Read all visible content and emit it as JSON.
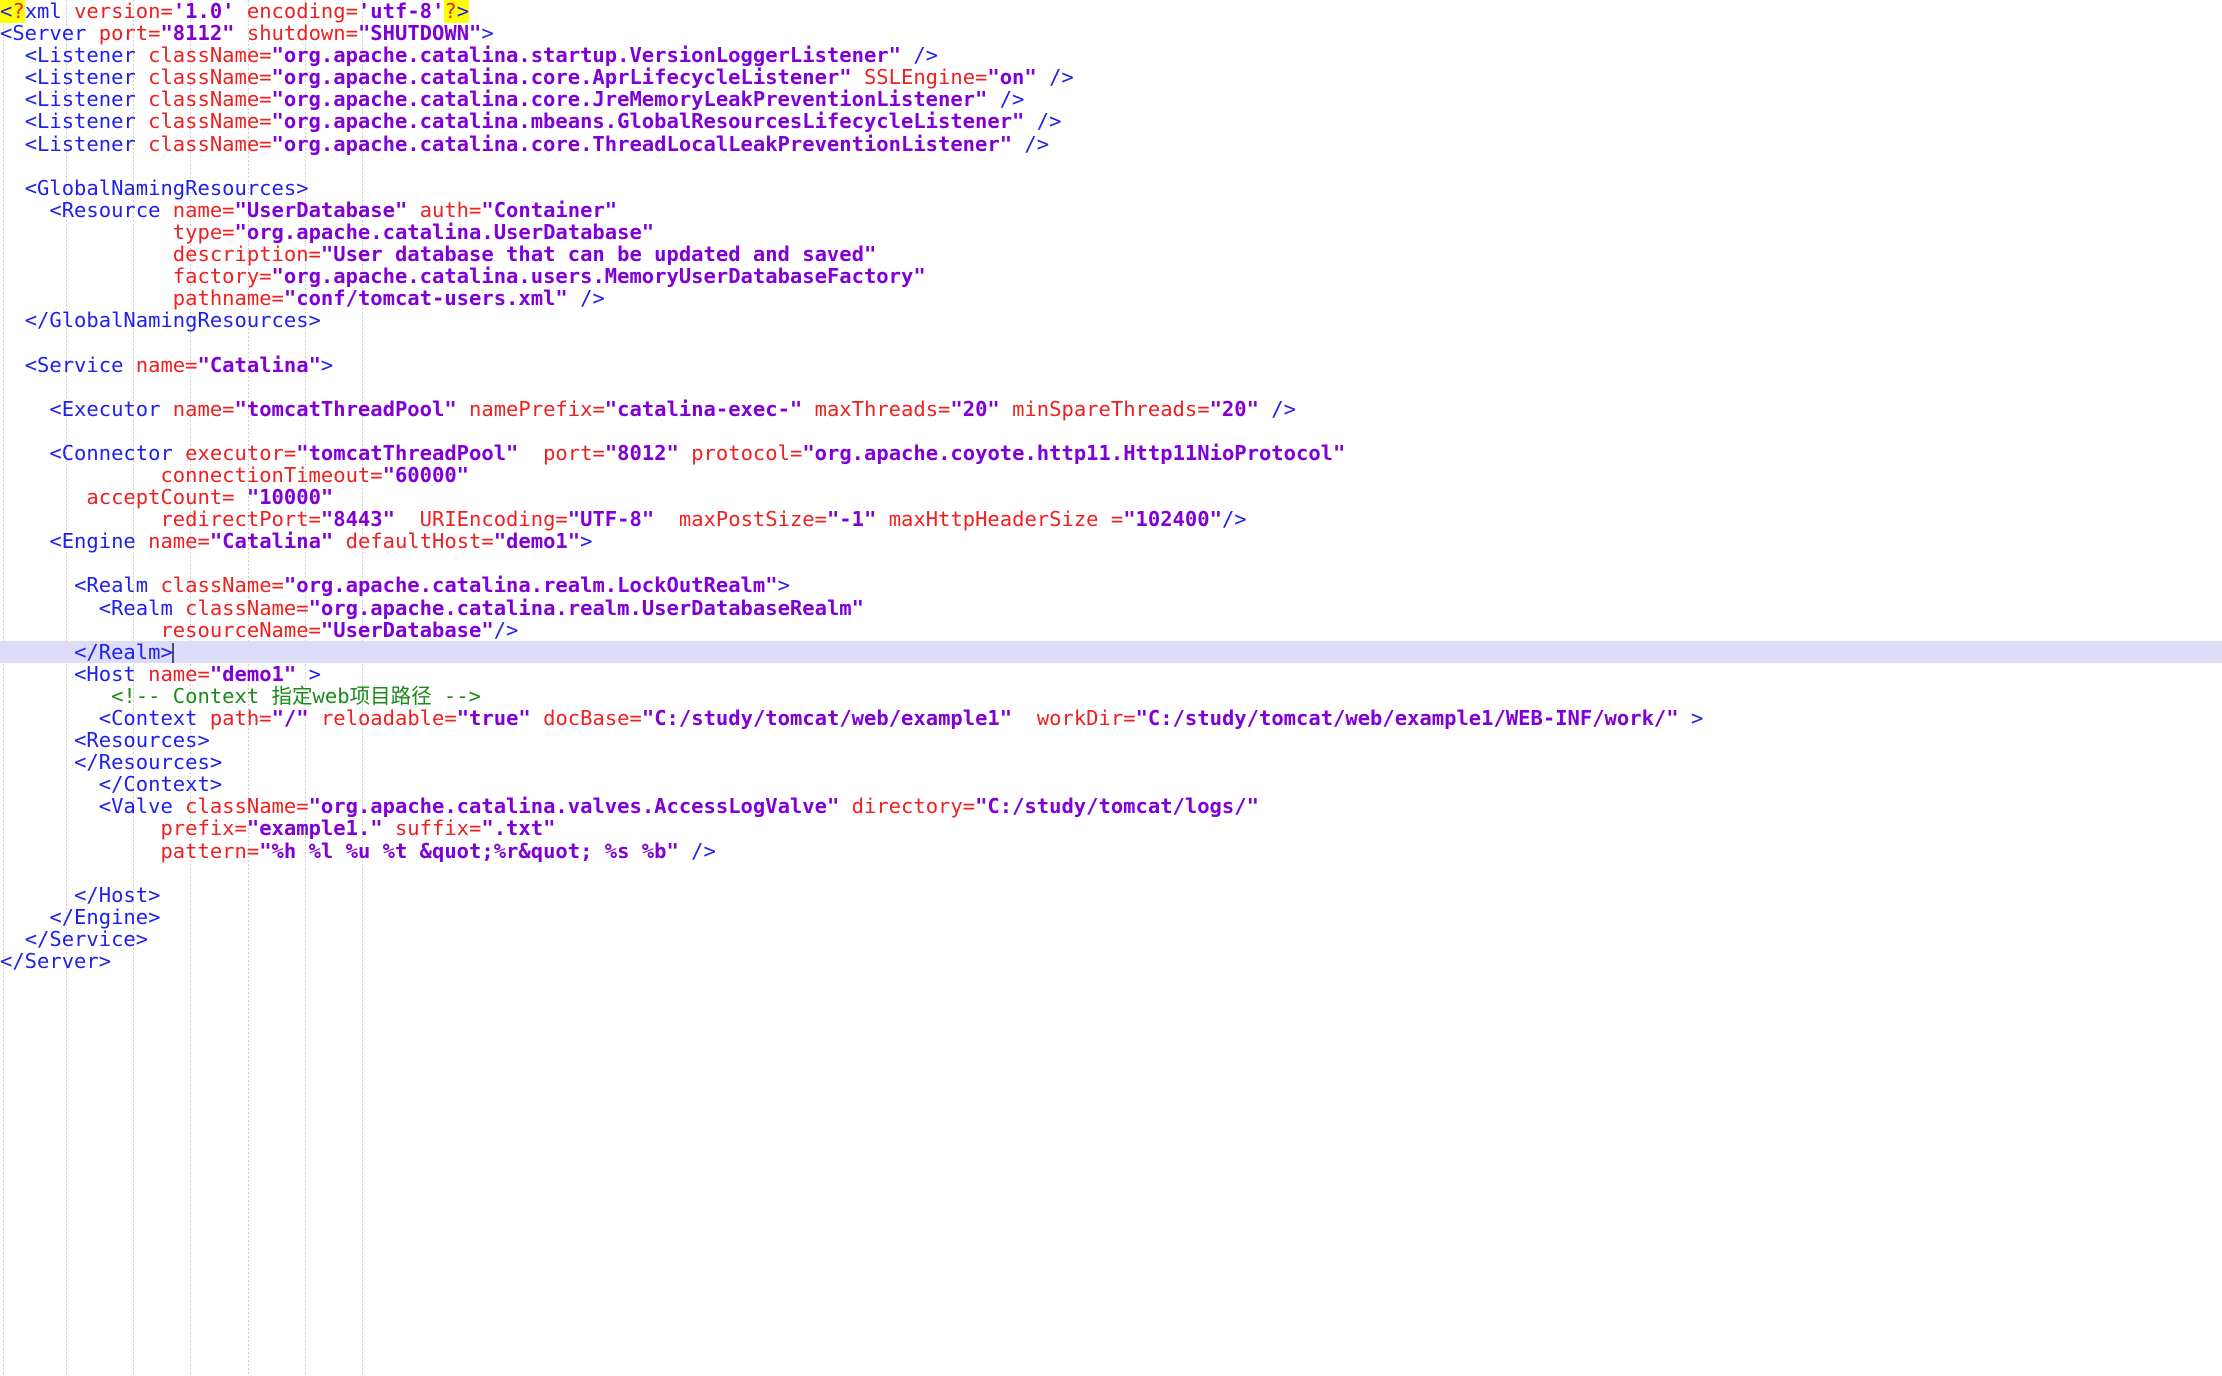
{
  "editor": {
    "language": "xml",
    "file_label": "server.xml",
    "current_line_index": 29,
    "colors": {
      "background": "#ffffff",
      "tag": "#2020ee",
      "attribute": "#ee2020",
      "value": "#8000d7",
      "comment": "#1a8a1a",
      "match_highlight": "#ffff00",
      "current_line": "#dcdcf7",
      "indent_guide": "#d0d0d0",
      "caret": "#4a4a88"
    },
    "indent_guide_x": [
      3,
      66,
      133,
      190,
      248,
      305,
      362
    ]
  },
  "lines": [
    {
      "indent": 0,
      "tokens": [
        {
          "t": "tag",
          "s": "<",
          "hl": true
        },
        {
          "t": "qmark",
          "s": "?",
          "hl": true
        },
        {
          "t": "tag",
          "s": "xml"
        },
        {
          "t": "plain",
          "s": " "
        },
        {
          "t": "attr",
          "s": "version="
        },
        {
          "t": "val",
          "s": "'1.0'"
        },
        {
          "t": "plain",
          "s": " "
        },
        {
          "t": "attr",
          "s": "encoding="
        },
        {
          "t": "val",
          "s": "'utf-8'"
        },
        {
          "t": "qmark",
          "s": "?",
          "hl": true
        },
        {
          "t": "tag",
          "s": ">",
          "hl": true
        }
      ]
    },
    {
      "indent": 0,
      "tokens": [
        {
          "t": "tag",
          "s": "<Server "
        },
        {
          "t": "attr",
          "s": "port="
        },
        {
          "t": "val",
          "s": "\"8112\""
        },
        {
          "t": "plain",
          "s": " "
        },
        {
          "t": "attr",
          "s": "shutdown="
        },
        {
          "t": "val",
          "s": "\"SHUTDOWN\""
        },
        {
          "t": "tag",
          "s": ">"
        }
      ]
    },
    {
      "indent": 0,
      "tokens": [
        {
          "t": "plain",
          "s": "  "
        },
        {
          "t": "tag",
          "s": "<Listener "
        },
        {
          "t": "attr",
          "s": "className="
        },
        {
          "t": "val",
          "s": "\"org.apache.catalina.startup.VersionLoggerListener\""
        },
        {
          "t": "tag",
          "s": " />"
        }
      ]
    },
    {
      "indent": 0,
      "tokens": [
        {
          "t": "plain",
          "s": "  "
        },
        {
          "t": "tag",
          "s": "<Listener "
        },
        {
          "t": "attr",
          "s": "className="
        },
        {
          "t": "val",
          "s": "\"org.apache.catalina.core.AprLifecycleListener\""
        },
        {
          "t": "plain",
          "s": " "
        },
        {
          "t": "attr",
          "s": "SSLEngine="
        },
        {
          "t": "val",
          "s": "\"on\""
        },
        {
          "t": "tag",
          "s": " />"
        }
      ]
    },
    {
      "indent": 0,
      "tokens": [
        {
          "t": "plain",
          "s": "  "
        },
        {
          "t": "tag",
          "s": "<Listener "
        },
        {
          "t": "attr",
          "s": "className="
        },
        {
          "t": "val",
          "s": "\"org.apache.catalina.core.JreMemoryLeakPreventionListener\""
        },
        {
          "t": "tag",
          "s": " />"
        }
      ]
    },
    {
      "indent": 0,
      "tokens": [
        {
          "t": "plain",
          "s": "  "
        },
        {
          "t": "tag",
          "s": "<Listener "
        },
        {
          "t": "attr",
          "s": "className="
        },
        {
          "t": "val",
          "s": "\"org.apache.catalina.mbeans.GlobalResourcesLifecycleListener\""
        },
        {
          "t": "tag",
          "s": " />"
        }
      ]
    },
    {
      "indent": 0,
      "tokens": [
        {
          "t": "plain",
          "s": "  "
        },
        {
          "t": "tag",
          "s": "<Listener "
        },
        {
          "t": "attr",
          "s": "className="
        },
        {
          "t": "val",
          "s": "\"org.apache.catalina.core.ThreadLocalLeakPreventionListener\""
        },
        {
          "t": "tag",
          "s": " />"
        }
      ]
    },
    {
      "indent": 0,
      "tokens": []
    },
    {
      "indent": 0,
      "tokens": [
        {
          "t": "plain",
          "s": "  "
        },
        {
          "t": "tag",
          "s": "<GlobalNamingResources>"
        }
      ]
    },
    {
      "indent": 0,
      "tokens": [
        {
          "t": "plain",
          "s": "    "
        },
        {
          "t": "tag",
          "s": "<Resource "
        },
        {
          "t": "attr",
          "s": "name="
        },
        {
          "t": "val",
          "s": "\"UserDatabase\""
        },
        {
          "t": "plain",
          "s": " "
        },
        {
          "t": "attr",
          "s": "auth="
        },
        {
          "t": "val",
          "s": "\"Container\""
        }
      ]
    },
    {
      "indent": 0,
      "tokens": [
        {
          "t": "plain",
          "s": "              "
        },
        {
          "t": "attr",
          "s": "type="
        },
        {
          "t": "val",
          "s": "\"org.apache.catalina.UserDatabase\""
        }
      ]
    },
    {
      "indent": 0,
      "tokens": [
        {
          "t": "plain",
          "s": "              "
        },
        {
          "t": "attr",
          "s": "description="
        },
        {
          "t": "val",
          "s": "\"User database that can be updated and saved\""
        }
      ]
    },
    {
      "indent": 0,
      "tokens": [
        {
          "t": "plain",
          "s": "              "
        },
        {
          "t": "attr",
          "s": "factory="
        },
        {
          "t": "val",
          "s": "\"org.apache.catalina.users.MemoryUserDatabaseFactory\""
        }
      ]
    },
    {
      "indent": 0,
      "tokens": [
        {
          "t": "plain",
          "s": "              "
        },
        {
          "t": "attr",
          "s": "pathname="
        },
        {
          "t": "val",
          "s": "\"conf/tomcat-users.xml\""
        },
        {
          "t": "tag",
          "s": " />"
        }
      ]
    },
    {
      "indent": 0,
      "tokens": [
        {
          "t": "plain",
          "s": "  "
        },
        {
          "t": "tag",
          "s": "</GlobalNamingResources>"
        }
      ]
    },
    {
      "indent": 0,
      "tokens": []
    },
    {
      "indent": 0,
      "tokens": [
        {
          "t": "plain",
          "s": "  "
        },
        {
          "t": "tag",
          "s": "<Service "
        },
        {
          "t": "attr",
          "s": "name="
        },
        {
          "t": "val",
          "s": "\"Catalina\""
        },
        {
          "t": "tag",
          "s": ">"
        }
      ]
    },
    {
      "indent": 0,
      "tokens": []
    },
    {
      "indent": 0,
      "tokens": [
        {
          "t": "plain",
          "s": "    "
        },
        {
          "t": "tag",
          "s": "<Executor "
        },
        {
          "t": "attr",
          "s": "name="
        },
        {
          "t": "val",
          "s": "\"tomcatThreadPool\""
        },
        {
          "t": "plain",
          "s": " "
        },
        {
          "t": "attr",
          "s": "namePrefix="
        },
        {
          "t": "val",
          "s": "\"catalina-exec-\""
        },
        {
          "t": "plain",
          "s": " "
        },
        {
          "t": "attr",
          "s": "maxThreads="
        },
        {
          "t": "val",
          "s": "\"20\""
        },
        {
          "t": "plain",
          "s": " "
        },
        {
          "t": "attr",
          "s": "minSpareThreads="
        },
        {
          "t": "val",
          "s": "\"20\""
        },
        {
          "t": "tag",
          "s": " />"
        }
      ]
    },
    {
      "indent": 0,
      "tokens": []
    },
    {
      "indent": 0,
      "tokens": [
        {
          "t": "plain",
          "s": "    "
        },
        {
          "t": "tag",
          "s": "<Connector "
        },
        {
          "t": "attr",
          "s": "executor="
        },
        {
          "t": "val",
          "s": "\"tomcatThreadPool\""
        },
        {
          "t": "plain",
          "s": "  "
        },
        {
          "t": "attr",
          "s": "port="
        },
        {
          "t": "val",
          "s": "\"8012\""
        },
        {
          "t": "plain",
          "s": " "
        },
        {
          "t": "attr",
          "s": "protocol="
        },
        {
          "t": "val",
          "s": "\"org.apache.coyote.http11.Http11NioProtocol\""
        }
      ]
    },
    {
      "indent": 0,
      "tokens": [
        {
          "t": "plain",
          "s": "             "
        },
        {
          "t": "attr",
          "s": "connectionTimeout="
        },
        {
          "t": "val",
          "s": "\"60000\""
        }
      ]
    },
    {
      "indent": 0,
      "tokens": [
        {
          "t": "plain",
          "s": "       "
        },
        {
          "t": "attr",
          "s": "acceptCount="
        },
        {
          "t": "plain",
          "s": " "
        },
        {
          "t": "val",
          "s": "\"10000\""
        }
      ]
    },
    {
      "indent": 0,
      "tokens": [
        {
          "t": "plain",
          "s": "             "
        },
        {
          "t": "attr",
          "s": "redirectPort="
        },
        {
          "t": "val",
          "s": "\"8443\""
        },
        {
          "t": "plain",
          "s": "  "
        },
        {
          "t": "attr",
          "s": "URIEncoding="
        },
        {
          "t": "val",
          "s": "\"UTF-8\""
        },
        {
          "t": "plain",
          "s": "  "
        },
        {
          "t": "attr",
          "s": "maxPostSize="
        },
        {
          "t": "val",
          "s": "\"-1\""
        },
        {
          "t": "plain",
          "s": " "
        },
        {
          "t": "attr",
          "s": "maxHttpHeaderSize ="
        },
        {
          "t": "val",
          "s": "\"102400\""
        },
        {
          "t": "tag",
          "s": "/>"
        }
      ]
    },
    {
      "indent": 0,
      "tokens": [
        {
          "t": "plain",
          "s": "    "
        },
        {
          "t": "tag",
          "s": "<Engine "
        },
        {
          "t": "attr",
          "s": "name="
        },
        {
          "t": "val",
          "s": "\"Catalina\""
        },
        {
          "t": "plain",
          "s": " "
        },
        {
          "t": "attr",
          "s": "defaultHost="
        },
        {
          "t": "val",
          "s": "\"demo1\""
        },
        {
          "t": "tag",
          "s": ">"
        }
      ]
    },
    {
      "indent": 0,
      "tokens": []
    },
    {
      "indent": 0,
      "tokens": [
        {
          "t": "plain",
          "s": "      "
        },
        {
          "t": "tag",
          "s": "<Realm "
        },
        {
          "t": "attr",
          "s": "className="
        },
        {
          "t": "val",
          "s": "\"org.apache.catalina.realm.LockOutRealm\""
        },
        {
          "t": "tag",
          "s": ">"
        }
      ]
    },
    {
      "indent": 0,
      "tokens": [
        {
          "t": "plain",
          "s": "        "
        },
        {
          "t": "tag",
          "s": "<Realm "
        },
        {
          "t": "attr",
          "s": "className="
        },
        {
          "t": "val",
          "s": "\"org.apache.catalina.realm.UserDatabaseRealm\""
        }
      ]
    },
    {
      "indent": 0,
      "tokens": [
        {
          "t": "plain",
          "s": "             "
        },
        {
          "t": "attr",
          "s": "resourceName="
        },
        {
          "t": "val",
          "s": "\"UserDatabase\""
        },
        {
          "t": "tag",
          "s": "/>"
        }
      ]
    },
    {
      "indent": 0,
      "current": true,
      "caret_after": true,
      "tokens": [
        {
          "t": "plain",
          "s": "      "
        },
        {
          "t": "tag",
          "s": "</Realm>"
        }
      ]
    },
    {
      "indent": 0,
      "tokens": [
        {
          "t": "plain",
          "s": "      "
        },
        {
          "t": "tag",
          "s": "<Host "
        },
        {
          "t": "attr",
          "s": "name="
        },
        {
          "t": "val",
          "s": "\"demo1\""
        },
        {
          "t": "tag",
          "s": " >"
        }
      ]
    },
    {
      "indent": 0,
      "tokens": [
        {
          "t": "plain",
          "s": "         "
        },
        {
          "t": "comment",
          "s": "<!-- Context 指定web项目路径 -->"
        }
      ]
    },
    {
      "indent": 0,
      "tokens": [
        {
          "t": "plain",
          "s": "        "
        },
        {
          "t": "tag",
          "s": "<Context "
        },
        {
          "t": "attr",
          "s": "path="
        },
        {
          "t": "val",
          "s": "\"/\""
        },
        {
          "t": "plain",
          "s": " "
        },
        {
          "t": "attr",
          "s": "reloadable="
        },
        {
          "t": "val",
          "s": "\"true\""
        },
        {
          "t": "plain",
          "s": " "
        },
        {
          "t": "attr",
          "s": "docBase="
        },
        {
          "t": "val",
          "s": "\"C:/study/tomcat/web/example1\""
        },
        {
          "t": "plain",
          "s": "  "
        },
        {
          "t": "attr",
          "s": "workDir="
        },
        {
          "t": "val",
          "s": "\"C:/study/tomcat/web/example1/WEB-INF/work/\""
        },
        {
          "t": "tag",
          "s": " >"
        }
      ]
    },
    {
      "indent": 0,
      "tokens": [
        {
          "t": "plain",
          "s": "      "
        },
        {
          "t": "tag",
          "s": "<Resources>"
        }
      ]
    },
    {
      "indent": 0,
      "tokens": [
        {
          "t": "plain",
          "s": "      "
        },
        {
          "t": "tag",
          "s": "</Resources>"
        }
      ]
    },
    {
      "indent": 0,
      "tokens": [
        {
          "t": "plain",
          "s": "        "
        },
        {
          "t": "tag",
          "s": "</Context>"
        }
      ]
    },
    {
      "indent": 0,
      "tokens": [
        {
          "t": "plain",
          "s": "        "
        },
        {
          "t": "tag",
          "s": "<Valve "
        },
        {
          "t": "attr",
          "s": "className="
        },
        {
          "t": "val",
          "s": "\"org.apache.catalina.valves.AccessLogValve\""
        },
        {
          "t": "plain",
          "s": " "
        },
        {
          "t": "attr",
          "s": "directory="
        },
        {
          "t": "val",
          "s": "\"C:/study/tomcat/logs/\""
        }
      ]
    },
    {
      "indent": 0,
      "tokens": [
        {
          "t": "plain",
          "s": "             "
        },
        {
          "t": "attr",
          "s": "prefix="
        },
        {
          "t": "val",
          "s": "\"example1.\""
        },
        {
          "t": "plain",
          "s": " "
        },
        {
          "t": "attr",
          "s": "suffix="
        },
        {
          "t": "val",
          "s": "\".txt\""
        }
      ]
    },
    {
      "indent": 0,
      "tokens": [
        {
          "t": "plain",
          "s": "             "
        },
        {
          "t": "attr",
          "s": "pattern="
        },
        {
          "t": "val",
          "s": "\"%h %l %u %t &quot;%r&quot; %s %b\""
        },
        {
          "t": "tag",
          "s": " />"
        }
      ]
    },
    {
      "indent": 0,
      "tokens": []
    },
    {
      "indent": 0,
      "tokens": [
        {
          "t": "plain",
          "s": "      "
        },
        {
          "t": "tag",
          "s": "</Host>"
        }
      ]
    },
    {
      "indent": 0,
      "tokens": [
        {
          "t": "plain",
          "s": "    "
        },
        {
          "t": "tag",
          "s": "</Engine>"
        }
      ]
    },
    {
      "indent": 0,
      "tokens": [
        {
          "t": "plain",
          "s": "  "
        },
        {
          "t": "tag",
          "s": "</Service>"
        }
      ]
    },
    {
      "indent": 0,
      "tokens": [
        {
          "t": "tag",
          "s": "</Server>"
        }
      ]
    }
  ]
}
